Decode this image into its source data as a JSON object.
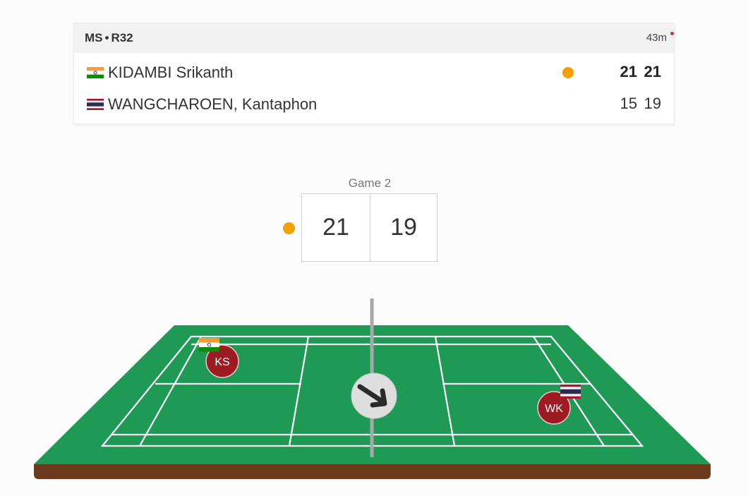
{
  "match": {
    "event": "MS",
    "round": "R32",
    "duration": "43m"
  },
  "players": [
    {
      "name": "KIDAMBI Srikanth",
      "country": "IND",
      "flag_icon": "india-flag-icon",
      "game_scores": [
        "21",
        "21"
      ],
      "serving": true
    },
    {
      "name": "WANGCHAROEN, Kantaphon",
      "country": "THA",
      "flag_icon": "thailand-flag-icon",
      "game_scores": [
        "15",
        "19"
      ],
      "serving": false
    }
  ],
  "current_game": {
    "label": "Game 2",
    "score_left": "21",
    "score_right": "19"
  },
  "court": {
    "left_player_initials": "KS",
    "right_player_initials": "WK",
    "direction_icon": "arrow-down-right-icon"
  },
  "colors": {
    "court_green": "#1e9a55",
    "court_base": "#6b3a1c",
    "player_marker": "#9d1c24",
    "serve_indicator": "#f5a000"
  }
}
